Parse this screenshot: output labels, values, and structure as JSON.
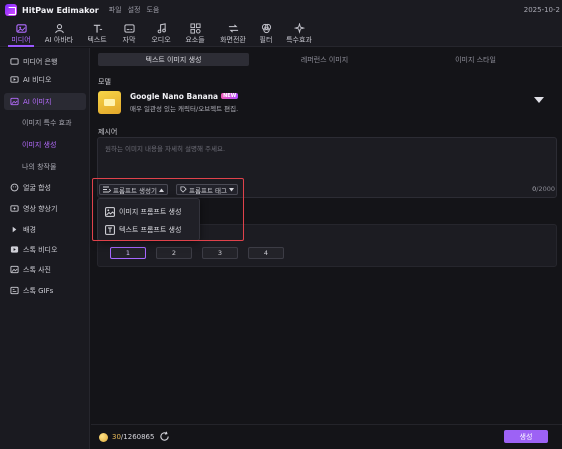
{
  "titlebar": {
    "app_name": "HitPaw Edimakor",
    "menu": [
      "파일",
      "설정",
      "도움"
    ],
    "date": "2025-10-2"
  },
  "toolbar": {
    "items": [
      {
        "label": "미디어",
        "icon": "media-icon",
        "active": true
      },
      {
        "label": "AI 아바타",
        "icon": "ai-avatar-icon"
      },
      {
        "label": "텍스트",
        "icon": "text-icon"
      },
      {
        "label": "자막",
        "icon": "subtitle-icon"
      },
      {
        "label": "오디오",
        "icon": "audio-icon"
      },
      {
        "label": "요소들",
        "icon": "elements-icon"
      },
      {
        "label": "화면전환",
        "icon": "transition-icon"
      },
      {
        "label": "필터",
        "icon": "filter-icon"
      },
      {
        "label": "특수효과",
        "icon": "effects-icon"
      }
    ]
  },
  "sidebar": {
    "items": [
      {
        "label": "미디어 은행",
        "icon": "media-bank-icon"
      },
      {
        "label": "AI 비디오",
        "icon": "ai-video-icon"
      },
      {
        "label": "AI 이미지",
        "icon": "ai-image-icon",
        "selected": true
      },
      {
        "label": "얼굴 합성",
        "icon": "face-swap-icon"
      },
      {
        "label": "영상 향상기",
        "icon": "enhancer-icon"
      },
      {
        "label": "배경",
        "icon": "background-icon"
      },
      {
        "label": "스톡 비디오",
        "icon": "stock-video-icon"
      },
      {
        "label": "스톡 사진",
        "icon": "stock-photo-icon"
      },
      {
        "label": "스톡 GIFs",
        "icon": "stock-gif-icon"
      }
    ],
    "sub_items": [
      {
        "label": "이미지 특수 효과"
      },
      {
        "label": "이미지 생성",
        "active": true
      },
      {
        "label": "나의 창작물"
      }
    ]
  },
  "tabs": [
    {
      "label": "텍스트 이미지 생성",
      "active": true
    },
    {
      "label": "레퍼런스 이미지"
    },
    {
      "label": "이미지 스타일"
    }
  ],
  "model": {
    "section_label": "모델",
    "name": "Google Nano Banana",
    "badge": "NEW",
    "description": "매우 일관성 있는 캐릭터/오브젝트 편집."
  },
  "prompt": {
    "section_label": "제시어",
    "placeholder": "원하는 이미지 내용을 자세히 설명해 주세요.",
    "generator_label": "프롬프트 생성기",
    "tag_label": "프롬프트 태그",
    "count": "0",
    "max": "/2000"
  },
  "popup": {
    "items": [
      {
        "label": "이미지 프롬프트 생성",
        "icon": "image-icon"
      },
      {
        "label": "텍스트 프롬프트 생성",
        "icon": "text-box-icon"
      }
    ]
  },
  "ratio": {
    "options": [
      "1",
      "2",
      "3",
      "4"
    ],
    "selected": "1"
  },
  "footer": {
    "credits_used": "30",
    "credits_total": "/1260865",
    "generate_label": "생성"
  },
  "colors": {
    "accent": "#9d62f5",
    "highlight": "#e0424b"
  }
}
